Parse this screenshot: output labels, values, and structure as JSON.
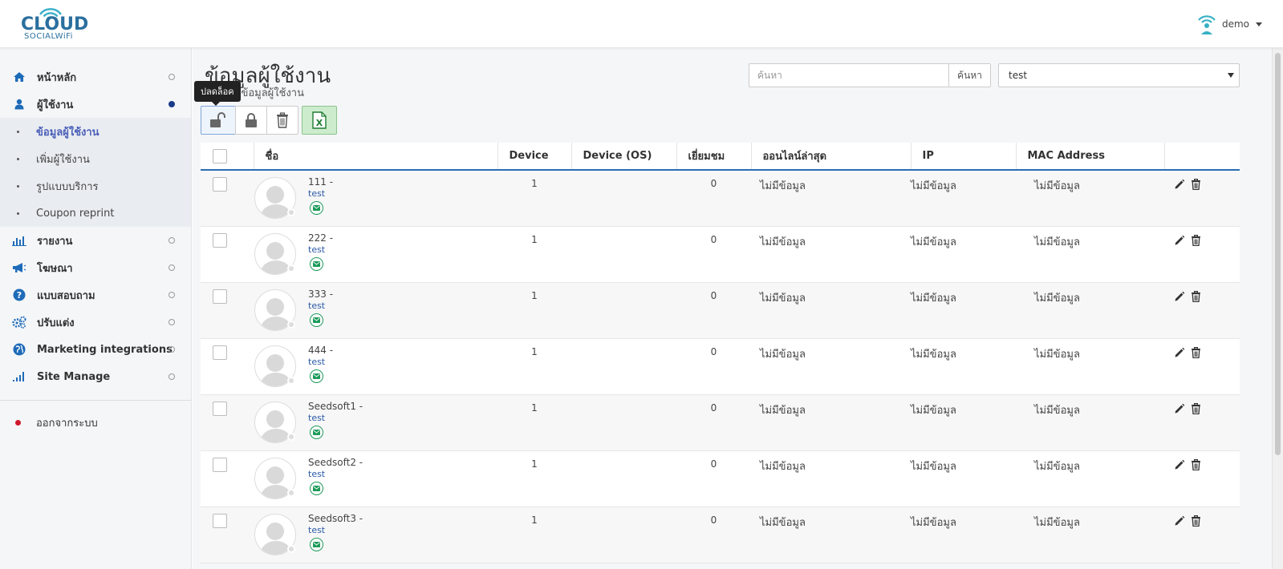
{
  "header": {
    "logo_main": "CLOUD",
    "logo_sub": "SOCIALWiFi",
    "username": "demo"
  },
  "sidebar": {
    "items": [
      {
        "label": "หน้าหลัก",
        "icon": "home-icon"
      },
      {
        "label": "ผู้ใช้งาน",
        "icon": "user-icon"
      },
      {
        "label": "รายงาน",
        "icon": "bar-chart-icon"
      },
      {
        "label": "โฆษณา",
        "icon": "megaphone-icon"
      },
      {
        "label": "แบบสอบถาม",
        "icon": "question-icon"
      },
      {
        "label": "ปรับแต่ง",
        "icon": "gears-icon"
      },
      {
        "label": "Marketing integrations",
        "icon": "globe-icon"
      },
      {
        "label": "Site Manage",
        "icon": "signal-icon"
      }
    ],
    "sub_items": [
      {
        "label": "ข้อมูลผู้ใช้งาน"
      },
      {
        "label": "เพิ่มผู้ใช้งาน"
      },
      {
        "label": "รูปแบบบริการ"
      },
      {
        "label": "Coupon reprint"
      }
    ],
    "logout": "ออกจากระบบ"
  },
  "main": {
    "title": "ข้อมูลผู้ใช้งาน",
    "subtitle": "ดข้อมูลผู้ใช้งาน",
    "search": {
      "placeholder": "ค้นหา",
      "button": "ค้นหา"
    },
    "site_select": "test",
    "tooltip": "ปลดล็อค"
  },
  "table": {
    "headers": [
      "ชื่อ",
      "Device",
      "Device (OS)",
      "เยี่ยมชม",
      "ออนไลน์ล่าสุด",
      "IP",
      "MAC Address"
    ],
    "rows": [
      {
        "name": "111 -",
        "sub": "test",
        "device": "1",
        "device_os": "",
        "visits": "0",
        "last_online": "ไม่มีข้อมูล",
        "ip": "ไม่มีข้อมูล",
        "mac": "ไม่มีข้อมูล"
      },
      {
        "name": "222 -",
        "sub": "test",
        "device": "1",
        "device_os": "",
        "visits": "0",
        "last_online": "ไม่มีข้อมูล",
        "ip": "ไม่มีข้อมูล",
        "mac": "ไม่มีข้อมูล"
      },
      {
        "name": "333 -",
        "sub": "test",
        "device": "1",
        "device_os": "",
        "visits": "0",
        "last_online": "ไม่มีข้อมูล",
        "ip": "ไม่มีข้อมูล",
        "mac": "ไม่มีข้อมูล"
      },
      {
        "name": "444 -",
        "sub": "test",
        "device": "1",
        "device_os": "",
        "visits": "0",
        "last_online": "ไม่มีข้อมูล",
        "ip": "ไม่มีข้อมูล",
        "mac": "ไม่มีข้อมูล"
      },
      {
        "name": "Seedsoft1 -",
        "sub": "test",
        "device": "1",
        "device_os": "",
        "visits": "0",
        "last_online": "ไม่มีข้อมูล",
        "ip": "ไม่มีข้อมูล",
        "mac": "ไม่มีข้อมูล"
      },
      {
        "name": "Seedsoft2 -",
        "sub": "test",
        "device": "1",
        "device_os": "",
        "visits": "0",
        "last_online": "ไม่มีข้อมูล",
        "ip": "ไม่มีข้อมูล",
        "mac": "ไม่มีข้อมูล"
      },
      {
        "name": "Seedsoft3 -",
        "sub": "test",
        "device": "1",
        "device_os": "",
        "visits": "0",
        "last_online": "ไม่มีข้อมูล",
        "ip": "ไม่มีข้อมูล",
        "mac": "ไม่มีข้อมูล"
      }
    ]
  },
  "colors": {
    "brand": "#2a6f9e",
    "accent": "#2a6db3",
    "active_nav": "#4a5fb8",
    "logout_dot": "#d0182b",
    "excel_green": "#1e7d32"
  }
}
